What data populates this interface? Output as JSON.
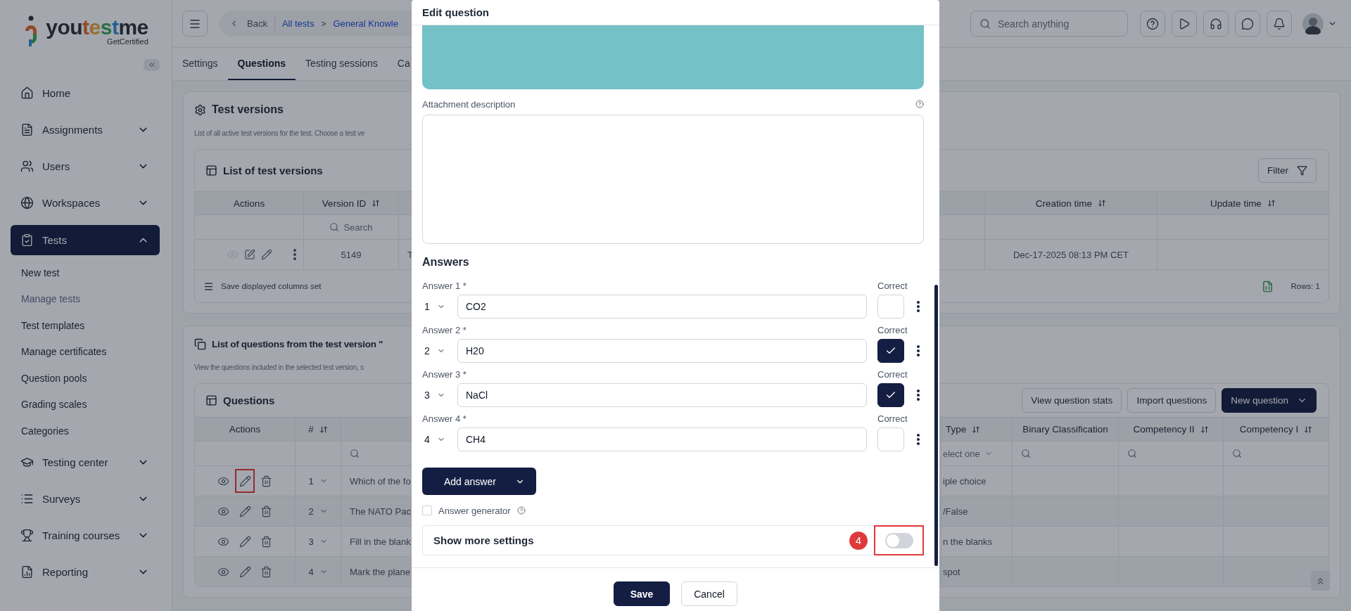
{
  "sidebar": {
    "logo": {
      "name": "youtestme",
      "tagline": "GetCertified"
    },
    "items": [
      {
        "label": "Home",
        "kind": "link",
        "selected": false
      },
      {
        "label": "Assignments",
        "kind": "group",
        "selected": false,
        "expanded": false
      },
      {
        "label": "Users",
        "kind": "group",
        "selected": false,
        "expanded": false
      },
      {
        "label": "Workspaces",
        "kind": "group",
        "selected": false,
        "expanded": false
      },
      {
        "label": "Tests",
        "kind": "group",
        "selected": true,
        "expanded": true,
        "children": [
          {
            "label": "New test",
            "selected": false
          },
          {
            "label": "Manage tests",
            "selected": true
          },
          {
            "label": "Test templates",
            "selected": false
          },
          {
            "label": "Manage certificates",
            "selected": false
          },
          {
            "label": "Question pools",
            "selected": false
          },
          {
            "label": "Grading scales",
            "selected": false
          },
          {
            "label": "Categories",
            "selected": false
          }
        ]
      },
      {
        "label": "Testing center",
        "kind": "group",
        "selected": false,
        "expanded": false
      },
      {
        "label": "Surveys",
        "kind": "group",
        "selected": false,
        "expanded": false
      },
      {
        "label": "Training courses",
        "kind": "group",
        "selected": false,
        "expanded": false
      },
      {
        "label": "Reporting",
        "kind": "group",
        "selected": false,
        "expanded": false
      }
    ]
  },
  "topbar": {
    "breadcrumb": {
      "back": "Back",
      "separator": ">",
      "items": [
        {
          "label": "All tests"
        },
        {
          "label": "General Knowle"
        }
      ]
    },
    "search": {
      "placeholder": "Search anything"
    }
  },
  "tabs": [
    {
      "label": "Settings",
      "selected": false
    },
    {
      "label": "Questions",
      "selected": true
    },
    {
      "label": "Testing sessions",
      "selected": false
    },
    {
      "label": "Ca",
      "selected": false
    }
  ],
  "test_versions": {
    "title": "Test versions",
    "description": "List of all active test versions for the test. Choose a test ve",
    "table": {
      "title": "List of test versions",
      "filter_button": "Filter",
      "columns": [
        {
          "label": "Actions",
          "sortable": false
        },
        {
          "label": "Version ID",
          "sortable": true
        },
        {
          "label": "Creation time",
          "sortable": true
        },
        {
          "label": "Update time",
          "sortable": true
        }
      ],
      "search_placeholder": "Search",
      "rows": [
        {
          "view_disabled": true,
          "version_id": "5149",
          "column_3": "T",
          "creation_time": "Dec-17-2025 08:13 PM CET"
        }
      ],
      "footer": "Save displayed columns set",
      "rows_count": "Rows: 1"
    }
  },
  "questions": {
    "title": "List of questions from the test version \"",
    "description": "View the questions included in the selected test version, s",
    "table": {
      "title": "Questions",
      "buttons": [
        "View question stats",
        "Import questions"
      ],
      "primary_button": "New question",
      "columns": [
        {
          "label": "Actions",
          "sortable": false
        },
        {
          "label": "#",
          "sortable": true
        },
        {
          "label": "Type",
          "sortable": true
        },
        {
          "label": "Binary Classification",
          "sortable": false
        },
        {
          "label": "Competency II",
          "sortable": true
        },
        {
          "label": "Competency I",
          "sortable": true
        }
      ],
      "type_filter": "elect one",
      "rows": [
        {
          "number": "1",
          "question": "Which of the fo",
          "type": "iple choice",
          "annotated": true
        },
        {
          "number": "2",
          "question": "The NATO Pac",
          "type": "/False",
          "annotated": false
        },
        {
          "number": "3",
          "question": "Fill in the blank",
          "type": "n the blanks",
          "annotated": false
        },
        {
          "number": "4",
          "question": "Mark the plane",
          "type": "spot",
          "annotated": false
        }
      ]
    }
  },
  "modal": {
    "title": "Edit question",
    "attachment_label": "Attachment description",
    "answers_title": "Answers",
    "answers": [
      {
        "label": "Answer 1 *",
        "order": "1",
        "value": "CO2",
        "correct_label": "Correct",
        "correct": false
      },
      {
        "label": "Answer 2 *",
        "order": "2",
        "value": "H20",
        "correct_label": "Correct",
        "correct": true
      },
      {
        "label": "Answer 3 *",
        "order": "3",
        "value": "NaCl",
        "correct_label": "Correct",
        "correct": true
      },
      {
        "label": "Answer 4 *",
        "order": "4",
        "value": "CH4",
        "correct_label": "Correct",
        "correct": false
      }
    ],
    "add_button": "Add answer",
    "answer_generator": {
      "label": "Answer generator",
      "checked": false
    },
    "more_settings": {
      "label": "Show more settings",
      "on": false,
      "step": "4"
    },
    "buttons": [
      {
        "label": "Save",
        "kind": "primary"
      },
      {
        "label": "Cancel",
        "kind": "secondary"
      }
    ]
  }
}
